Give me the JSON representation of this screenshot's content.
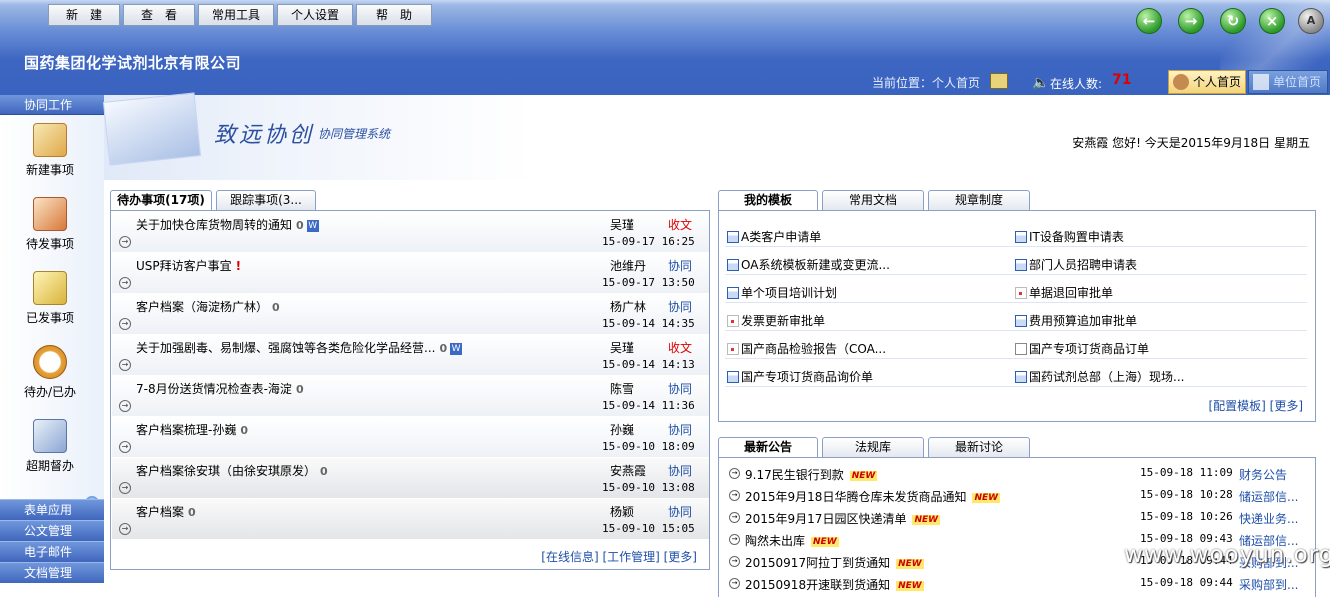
{
  "menu": [
    "新　建",
    "查　看",
    "常用工具",
    "个人设置",
    "帮　助"
  ],
  "company": "国药集团化学试剂北京有限公司",
  "location": "当前位置：个人首页",
  "online_label": "在线人数:",
  "online_count": "71",
  "header_tabs": {
    "home": "个人首页",
    "register": "单位首页"
  },
  "nav_icons": [
    "back-icon",
    "forward-icon",
    "refresh-icon",
    "close-icon",
    "logout-icon"
  ],
  "sidebar": {
    "head": "协同工作",
    "items": [
      "新建事项",
      "待发事项",
      "已发事项",
      "待办/已办",
      "超期督办"
    ],
    "bottom": [
      "表单应用",
      "公文管理",
      "电子邮件",
      "文档管理"
    ]
  },
  "banner": {
    "brand": "致远协创",
    "sub": "协同管理系统",
    "greeting": "安燕霞 您好! 今天是2015年9月18日 星期五"
  },
  "todo": {
    "tabs": [
      "待办事项(17项)",
      "跟踪事项(3..."
    ],
    "rows": [
      {
        "title": "关于加快仓库货物周转的通知",
        "clip": true,
        "doc": true,
        "bang": false,
        "who": "吴瑾",
        "kind": "收文",
        "red": true,
        "time": "15-09-17 16:25"
      },
      {
        "title": "USP拜访客户事宜",
        "clip": false,
        "doc": false,
        "bang": true,
        "who": "池维丹",
        "kind": "协同",
        "red": false,
        "time": "15-09-17 13:50"
      },
      {
        "title": "客户档案（海淀杨广林）",
        "clip": true,
        "doc": false,
        "bang": false,
        "who": "杨广林",
        "kind": "协同",
        "red": false,
        "time": "15-09-14 14:35"
      },
      {
        "title": "关于加强剧毒、易制爆、强腐蚀等各类危险化学品经营...",
        "clip": true,
        "doc": true,
        "bang": false,
        "who": "吴瑾",
        "kind": "收文",
        "red": true,
        "time": "15-09-14 14:13"
      },
      {
        "title": "7-8月份送货情况检查表-海淀",
        "clip": true,
        "doc": false,
        "bang": false,
        "who": "陈雪",
        "kind": "协同",
        "red": false,
        "time": "15-09-14 11:36"
      },
      {
        "title": "客户档案梳理-孙巍",
        "clip": true,
        "doc": false,
        "bang": false,
        "who": "孙巍",
        "kind": "协同",
        "red": false,
        "time": "15-09-10 18:09"
      },
      {
        "title": "客户档案徐安琪（由徐安琪原发）",
        "clip": true,
        "doc": false,
        "bang": false,
        "who": "安燕霞",
        "kind": "协同",
        "red": false,
        "time": "15-09-10 13:08"
      },
      {
        "title": "客户档案",
        "clip": true,
        "doc": false,
        "bang": false,
        "who": "杨颖",
        "kind": "协同",
        "red": false,
        "time": "15-09-10 15:05"
      }
    ],
    "footer": "[在线信息] [工作管理] [更多]"
  },
  "templates": {
    "tabs": [
      "我的模板",
      "常用文档",
      "规章制度"
    ],
    "items": [
      {
        "label": "A类客户申请单",
        "icon": "form"
      },
      {
        "label": "IT设备购置申请表",
        "icon": "form"
      },
      {
        "label": "OA系统模板新建或变更流...",
        "icon": "form"
      },
      {
        "label": "部门人员招聘申请表",
        "icon": "form"
      },
      {
        "label": "单个项目培训计划",
        "icon": "form"
      },
      {
        "label": "单据退回审批单",
        "icon": "red"
      },
      {
        "label": "发票更新审批单",
        "icon": "red"
      },
      {
        "label": "费用预算追加审批单",
        "icon": "form"
      },
      {
        "label": "国产商品检验报告（COA...",
        "icon": "red"
      },
      {
        "label": "国产专项订货商品订单",
        "icon": "plain"
      },
      {
        "label": "国产专项订货商品询价单",
        "icon": "form"
      },
      {
        "label": "国药试剂总部（上海）现场...",
        "icon": "form"
      }
    ],
    "footer": "[配置模板] [更多]"
  },
  "news": {
    "tabs": [
      "最新公告",
      "法规库",
      "最新讨论"
    ],
    "rows": [
      {
        "title": "9.17民生银行到款",
        "date": "15-09-18 11:09",
        "cat": "财务公告"
      },
      {
        "title": "2015年9月18日华腾仓库未发货商品通知",
        "date": "15-09-18 10:28",
        "cat": "储运部信..."
      },
      {
        "title": "2015年9月17日园区快递清单",
        "date": "15-09-18 10:26",
        "cat": "快递业务..."
      },
      {
        "title": "陶然未出库",
        "date": "15-09-18 09:43",
        "cat": "储运部信..."
      },
      {
        "title": "20150917阿拉丁到货通知",
        "date": "15-09-18 09:44",
        "cat": "采购部到..."
      },
      {
        "title": "20150918开速联到货通知",
        "date": "15-09-18 09:44",
        "cat": "采购部到..."
      }
    ],
    "new_badge": "NEW"
  },
  "watermark": "www.wooyun.org"
}
